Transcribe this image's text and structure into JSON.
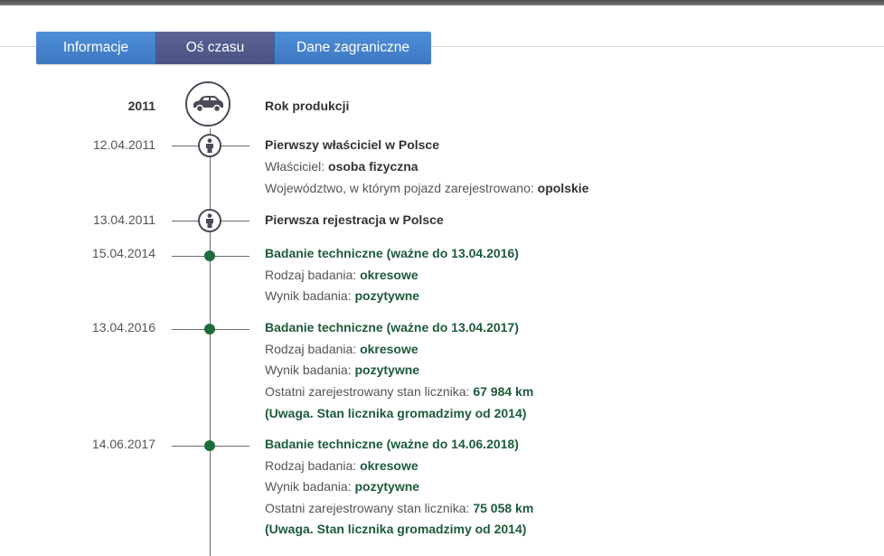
{
  "tabs": [
    {
      "label": "Informacje",
      "active": false
    },
    {
      "label": "Oś czasu",
      "active": true
    },
    {
      "label": "Dane zagraniczne",
      "active": false
    }
  ],
  "colors": {
    "tab_blue": "#4684cd",
    "tab_active": "#535c8e",
    "event_green": "#1d6b3a",
    "icon_dark": "#4a4a58"
  },
  "timeline": {
    "production": {
      "date": "2011",
      "icon": "car-icon",
      "title": "Rok produkcji"
    },
    "owner": {
      "date": "12.04.2011",
      "icon": "person-icon",
      "title": "Pierwszy właściciel w Polsce",
      "owner_label": "Właściciel: ",
      "owner_value": "osoba fizyczna",
      "region_label": "Województwo, w którym pojazd zarejestrowano: ",
      "region_value": "opolskie"
    },
    "registration": {
      "date": "13.04.2011",
      "icon": "person-icon",
      "title": "Pierwsza rejestracja w Polsce"
    },
    "inspection1": {
      "date": "15.04.2014",
      "title": "Badanie techniczne (ważne do 13.04.2016)",
      "type_label": "Rodzaj badania: ",
      "type_value": "okresowe",
      "result_label": "Wynik badania: ",
      "result_value": "pozytywne"
    },
    "inspection2": {
      "date": "13.04.2016",
      "title": "Badanie techniczne (ważne do 13.04.2017)",
      "type_label": "Rodzaj badania: ",
      "type_value": "okresowe",
      "result_label": "Wynik badania: ",
      "result_value": "pozytywne",
      "odometer_label": "Ostatni zarejestrowany stan licznika: ",
      "odometer_value": "67 984 km",
      "note": "(Uwaga. Stan licznika gromadzimy od 2014)"
    },
    "inspection3": {
      "date": "14.06.2017",
      "title": "Badanie techniczne (ważne do 14.06.2018)",
      "type_label": "Rodzaj badania: ",
      "type_value": "okresowe",
      "result_label": "Wynik badania: ",
      "result_value": "pozytywne",
      "odometer_label": "Ostatni zarejestrowany stan licznika: ",
      "odometer_value": "75 058 km",
      "note": "(Uwaga. Stan licznika gromadzimy od 2014)"
    }
  }
}
